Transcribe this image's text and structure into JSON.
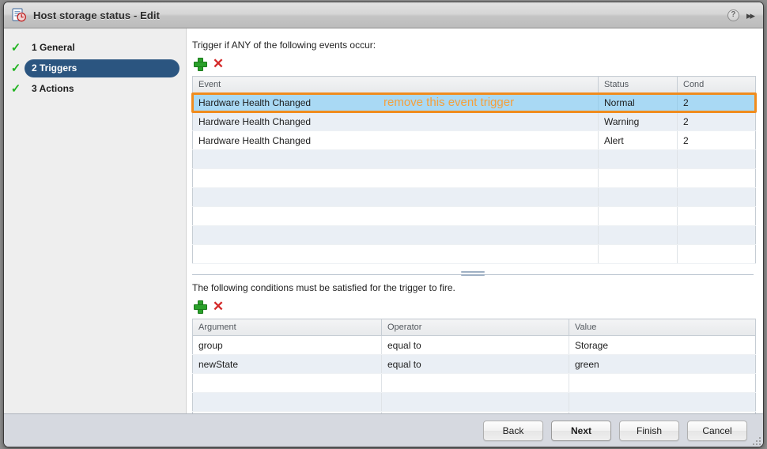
{
  "window": {
    "title": "Host storage status - Edit",
    "icon": "document-alarm-icon",
    "help_icon": "?",
    "expand_icon": "▸▸"
  },
  "sidebar": {
    "items": [
      {
        "num": "1",
        "label": "1 General",
        "icon": "check-icon",
        "active": false
      },
      {
        "num": "2",
        "label": "2 Triggers",
        "icon": "check-icon",
        "active": true
      },
      {
        "num": "3",
        "label": "3 Actions",
        "icon": "check-icon",
        "active": false
      }
    ]
  },
  "events_section": {
    "label": "Trigger if ANY of the following events occur:",
    "add_label": "+",
    "remove_label": "✕",
    "columns": [
      "Event",
      "Status",
      "Cond"
    ],
    "rows": [
      {
        "event": "Hardware Health Changed",
        "status": "Normal",
        "cond": "2",
        "selected": true
      },
      {
        "event": "Hardware Health Changed",
        "status": "Warning",
        "cond": "2",
        "selected": false
      },
      {
        "event": "Hardware Health Changed",
        "status": "Alert",
        "cond": "2",
        "selected": false
      },
      {
        "event": "",
        "status": "",
        "cond": "",
        "selected": false
      },
      {
        "event": "",
        "status": "",
        "cond": "",
        "selected": false
      },
      {
        "event": "",
        "status": "",
        "cond": "",
        "selected": false
      },
      {
        "event": "",
        "status": "",
        "cond": "",
        "selected": false
      },
      {
        "event": "",
        "status": "",
        "cond": "",
        "selected": false
      },
      {
        "event": "",
        "status": "",
        "cond": "",
        "selected": false
      }
    ]
  },
  "annotation": {
    "text": "remove this event trigger",
    "color": "#f5a03c",
    "ring_color": "#f08c1e"
  },
  "conditions_section": {
    "label": "The following conditions must be satisfied for the trigger to fire.",
    "add_label": "+",
    "remove_label": "✕",
    "columns": [
      "Argument",
      "Operator",
      "Value"
    ],
    "rows": [
      {
        "argument": "group",
        "operator": "equal to",
        "value": "Storage"
      },
      {
        "argument": "newState",
        "operator": "equal to",
        "value": "green"
      },
      {
        "argument": "",
        "operator": "",
        "value": ""
      },
      {
        "argument": "",
        "operator": "",
        "value": ""
      },
      {
        "argument": "",
        "operator": "",
        "value": ""
      }
    ]
  },
  "footer": {
    "buttons": [
      {
        "label": "Back",
        "default": false
      },
      {
        "label": "Next",
        "default": true
      },
      {
        "label": "Finish",
        "default": false
      },
      {
        "label": "Cancel",
        "default": false
      }
    ]
  }
}
